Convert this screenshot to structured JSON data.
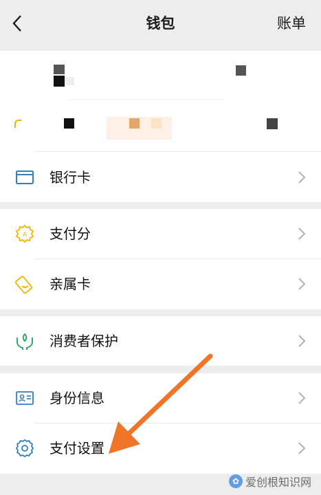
{
  "header": {
    "title": "钱包",
    "bill_label": "账单"
  },
  "section1": {
    "bank_card_label": "银行卡"
  },
  "section2": {
    "pay_score_label": "支付分",
    "family_card_label": "亲属卡"
  },
  "section3": {
    "consumer_protection_label": "消费者保护"
  },
  "section4": {
    "identity_label": "身份信息",
    "pay_settings_label": "支付设置"
  },
  "watermark": {
    "text": "爱创根知识网"
  },
  "colors": {
    "icon_blue": "#2f7fc1",
    "icon_yellow": "#f0b400",
    "icon_green": "#1fa35a",
    "arrow_orange": "#f07528",
    "chevron": "#b2b2b2"
  }
}
